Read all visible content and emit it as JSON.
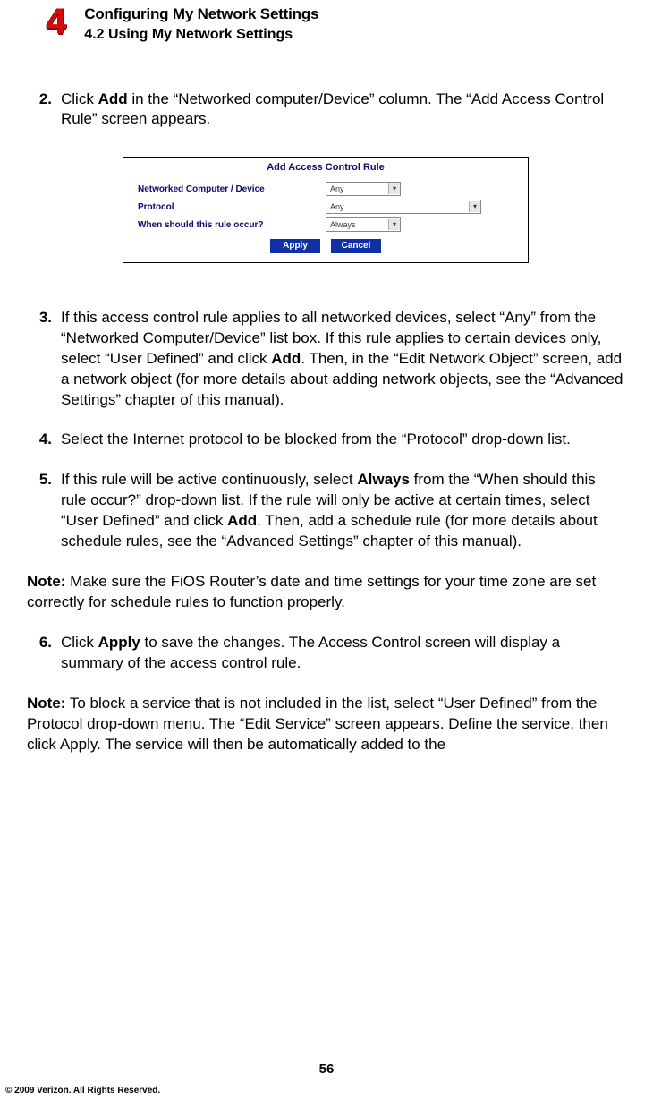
{
  "header": {
    "chapter_num": "4",
    "title": "Configuring My Network Settings",
    "subtitle": "4.2  Using My Network Settings"
  },
  "figure": {
    "title": "Add Access Control Rule",
    "rows": [
      {
        "label": "Networked Computer / Device",
        "value": "Any",
        "cls": "fig-sel-a"
      },
      {
        "label": "Protocol",
        "value": "Any",
        "cls": "fig-sel-b"
      },
      {
        "label": "When should this rule occur?",
        "value": "Always",
        "cls": "fig-sel-c"
      }
    ],
    "buttons": {
      "apply": "Apply",
      "cancel": "Cancel"
    }
  },
  "steps": {
    "s2": {
      "num": "2.",
      "pre": "Click ",
      "b1": "Add",
      "post": " in the “Networked computer/Device” column. The “Add Access Control Rule” screen appears."
    },
    "s3": {
      "num": "3.",
      "t1": "If this access control rule applies to all networked devices, select “Any” from the “Networked Computer/Device” list box. If this rule applies to certain devices only, select “User Defined” and click ",
      "b1": "Add",
      "t2": ". Then, in the “Edit Network Object” screen, add a network object (for more details about adding network objects, see the “Advanced Settings” chapter of this manual)."
    },
    "s4": {
      "num": "4.",
      "t1": "Select the Internet protocol to be blocked from the “Protocol” drop-down list."
    },
    "s5": {
      "num": "5.",
      "t1": "If this rule will be active continuously, select ",
      "b1": "Always",
      "t2": " from the “When should this rule occur?” drop-down list. If the rule will only be active at certain times, select “User Defined” and click ",
      "b2": "Add",
      "t3": ". Then, add a schedule rule (for more details about schedule rules, see the “Advanced Settings” chapter of this manual)."
    },
    "note1": {
      "b": "Note:",
      "t": " Make sure the FiOS Router’s date and time settings for your time zone are set correctly for schedule rules to function properly."
    },
    "s6": {
      "num": "6.",
      "t1": "Click ",
      "b1": "Apply",
      "t2": " to save the changes. The Access Control screen will display a summary of the access control rule."
    },
    "note2": {
      "b": "Note:",
      "t": " To block a service that is not included in the list, select “User Defined” from the Protocol drop-down menu. The “Edit Service” screen appears. Define the service, then click Apply. The service will then be automatically added to the"
    }
  },
  "footer": {
    "page": "56",
    "copyright": "© 2009 Verizon. All Rights Reserved."
  }
}
